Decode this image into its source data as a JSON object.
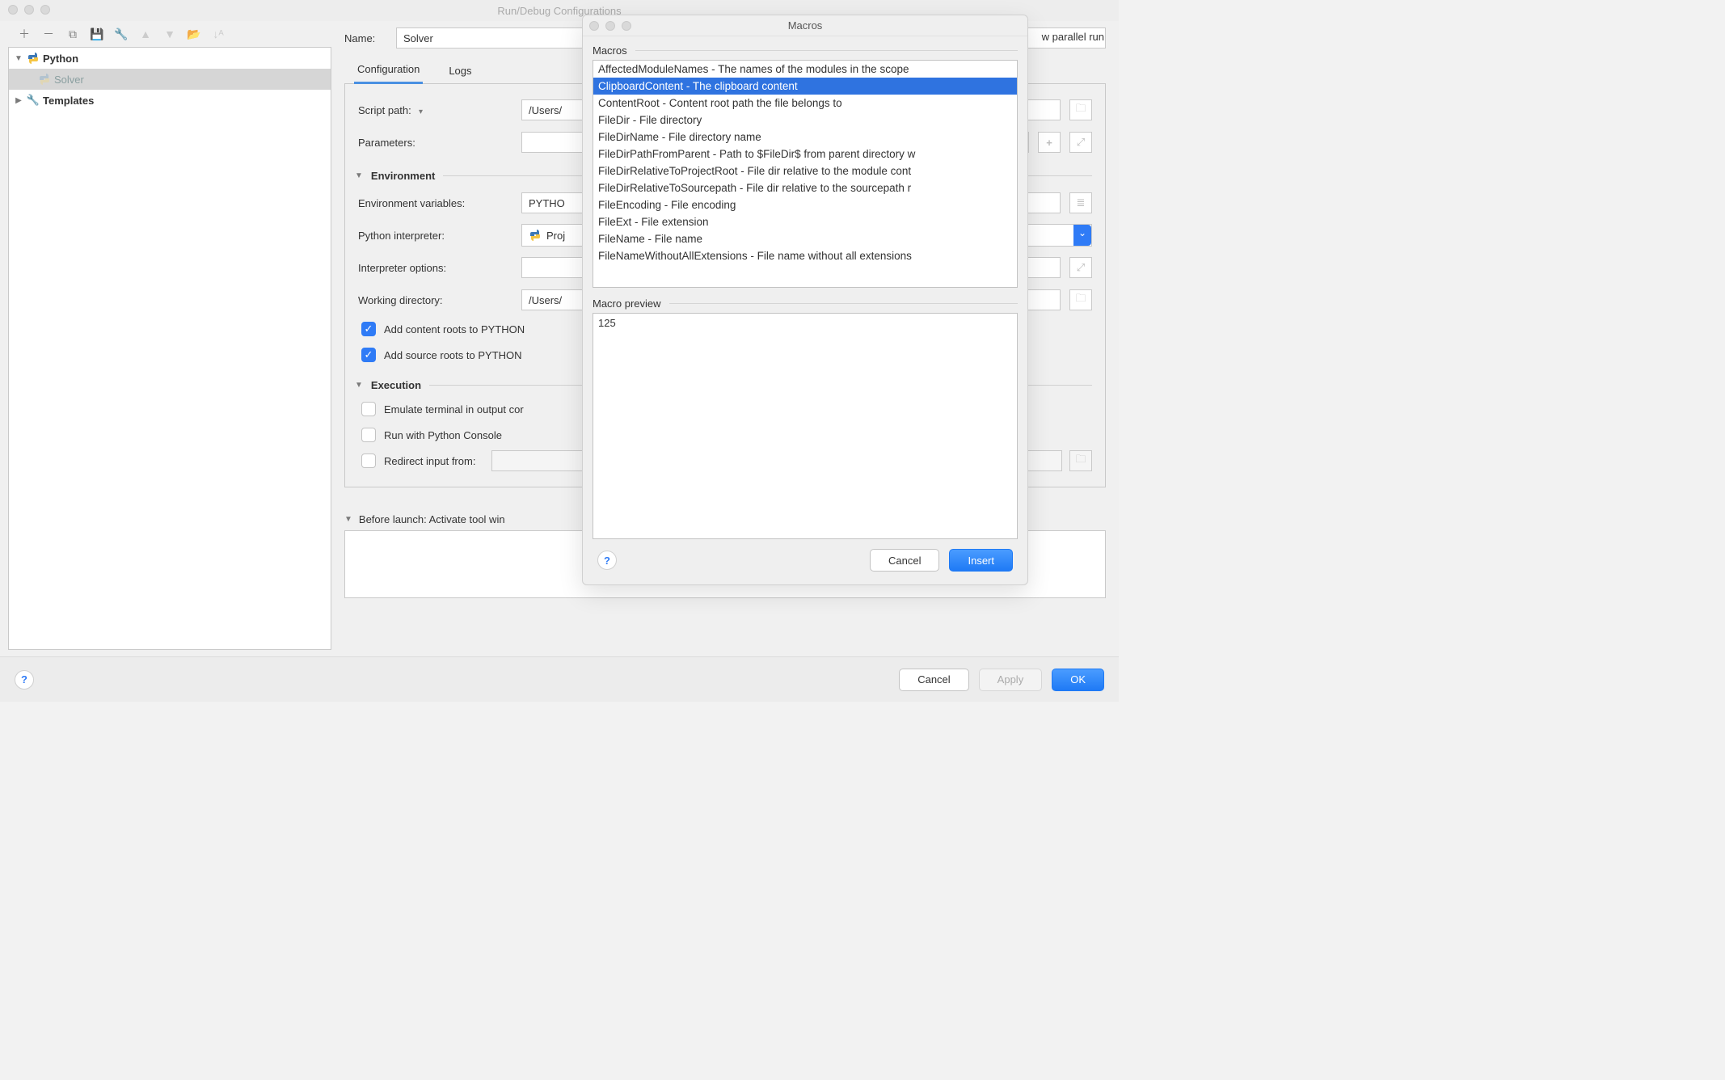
{
  "main": {
    "title": "Run/Debug Configurations",
    "parallel_run_label": "w parallel run",
    "name_label": "Name:",
    "name_value": "Solver",
    "tabs": {
      "configuration": "Configuration",
      "logs": "Logs"
    },
    "fields": {
      "script_path_label": "Script path:",
      "script_path_value": "/Users/",
      "parameters_label": "Parameters:",
      "parameters_value": "",
      "environment_section": "Environment",
      "env_vars_label": "Environment variables:",
      "env_vars_value": "PYTHO",
      "interpreter_label": "Python interpreter:",
      "interpreter_value": "Proj",
      "interpreter_options_label": "Interpreter options:",
      "interpreter_options_value": "",
      "working_dir_label": "Working directory:",
      "working_dir_value": "/Users/",
      "add_content_roots_label": "Add content roots to PYTHON",
      "add_source_roots_label": "Add source roots to PYTHON",
      "execution_section": "Execution",
      "emulate_terminal_label": "Emulate terminal in output cor",
      "run_console_label": "Run with Python Console",
      "redirect_input_label": "Redirect input from:"
    },
    "before_launch_label": "Before launch: Activate tool win",
    "footer": {
      "cancel": "Cancel",
      "apply": "Apply",
      "ok": "OK"
    }
  },
  "tree": {
    "python": "Python",
    "solver": "Solver",
    "templates": "Templates"
  },
  "macros": {
    "title": "Macros",
    "section_label": "Macros",
    "items": [
      "AffectedModuleNames - The names of the modules in the scope",
      "ClipboardContent - The clipboard content",
      "ContentRoot - Content root path the file belongs to",
      "FileDir - File directory",
      "FileDirName - File directory name",
      "FileDirPathFromParent - Path to $FileDir$ from parent directory w",
      "FileDirRelativeToProjectRoot - File dir relative to the module cont",
      "FileDirRelativeToSourcepath - File dir relative to the sourcepath r",
      "FileEncoding - File encoding",
      "FileExt - File extension",
      "FileName - File name",
      "FileNameWithoutAllExtensions - File name without all extensions"
    ],
    "selected_index": 1,
    "preview_label": "Macro preview",
    "preview_value": "125",
    "cancel": "Cancel",
    "insert": "Insert"
  }
}
